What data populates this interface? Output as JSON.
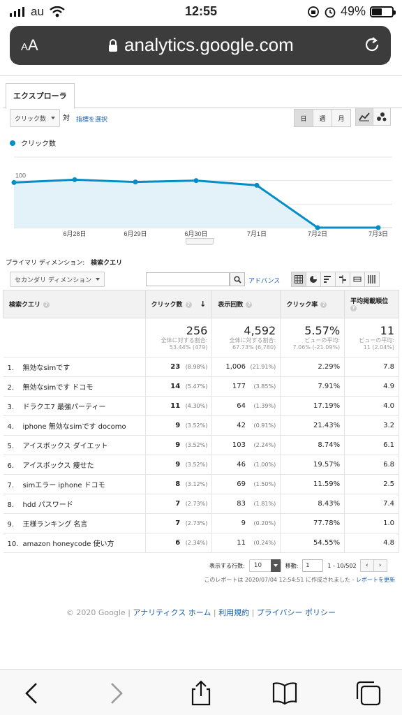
{
  "status": {
    "carrier": "au",
    "time": "12:55",
    "battery": "49%"
  },
  "browser": {
    "aa_label": "AA",
    "url": "analytics.google.com"
  },
  "tab": "エクスプローラ",
  "controls": {
    "metric_select": "クリック数",
    "vs_label": "対",
    "choose_metric": "指標を選択",
    "period_buttons": [
      "日",
      "週",
      "月"
    ]
  },
  "legend": "クリック数",
  "chart_data": {
    "type": "area",
    "series": [
      {
        "name": "クリック数",
        "values": [
          96,
          102,
          97,
          100,
          90,
          0,
          0
        ]
      }
    ],
    "x": [
      "",
      "6月28日",
      "6月29日",
      "6月30日",
      "7月1日",
      "7月2日",
      "7月3日"
    ],
    "yticks": [
      150,
      100,
      50
    ],
    "ylim": [
      0,
      150
    ],
    "color": "#058dc7"
  },
  "primary_dimension": {
    "label": "プライマリ ディメンション:",
    "value": "検索クエリ"
  },
  "secondary_dimension": "セカンダリ ディメンション",
  "advanced": "アドバンス",
  "table": {
    "headers": [
      "検索クエリ",
      "クリック数",
      "表示回数",
      "クリック率",
      "平均掲載順位"
    ],
    "totals": [
      {
        "big": "256",
        "sub1": "全体に対する割合:",
        "sub2": "53.44% (479)"
      },
      {
        "big": "4,592",
        "sub1": "全体に対する割合:",
        "sub2": "67.73% (6,780)"
      },
      {
        "big": "5.57%",
        "sub1": "ビューの平均:",
        "sub2": "7.06% (-21.09%)"
      },
      {
        "big": "11",
        "sub1": "ビューの平均:",
        "sub2": "11 (2.04%)"
      }
    ],
    "rows": [
      {
        "n": "1.",
        "q": "無効なsimです",
        "c": "23",
        "cp": "(8.98%)",
        "i": "1,006",
        "ip": "(21.91%)",
        "r": "2.29%",
        "p": "7.8"
      },
      {
        "n": "2.",
        "q": "無効なsimです ドコモ",
        "c": "14",
        "cp": "(5.47%)",
        "i": "177",
        "ip": "(3.85%)",
        "r": "7.91%",
        "p": "4.9"
      },
      {
        "n": "3.",
        "q": "ドラクエ7 最強パーティー",
        "c": "11",
        "cp": "(4.30%)",
        "i": "64",
        "ip": "(1.39%)",
        "r": "17.19%",
        "p": "4.0"
      },
      {
        "n": "4.",
        "q": "iphone 無効なsimです docomo",
        "c": "9",
        "cp": "(3.52%)",
        "i": "42",
        "ip": "(0.91%)",
        "r": "21.43%",
        "p": "3.2"
      },
      {
        "n": "5.",
        "q": "アイスボックス ダイエット",
        "c": "9",
        "cp": "(3.52%)",
        "i": "103",
        "ip": "(2.24%)",
        "r": "8.74%",
        "p": "6.1"
      },
      {
        "n": "6.",
        "q": "アイスボックス 痩せた",
        "c": "9",
        "cp": "(3.52%)",
        "i": "46",
        "ip": "(1.00%)",
        "r": "19.57%",
        "p": "6.8"
      },
      {
        "n": "7.",
        "q": "simエラー iphone ドコモ",
        "c": "8",
        "cp": "(3.12%)",
        "i": "69",
        "ip": "(1.50%)",
        "r": "11.59%",
        "p": "2.5"
      },
      {
        "n": "8.",
        "q": "hdd パスワード",
        "c": "7",
        "cp": "(2.73%)",
        "i": "83",
        "ip": "(1.81%)",
        "r": "8.43%",
        "p": "7.4"
      },
      {
        "n": "9.",
        "q": "王様ランキング 名言",
        "c": "7",
        "cp": "(2.73%)",
        "i": "9",
        "ip": "(0.20%)",
        "r": "77.78%",
        "p": "1.0"
      },
      {
        "n": "10.",
        "q": "amazon honeycode 使い方",
        "c": "6",
        "cp": "(2.34%)",
        "i": "11",
        "ip": "(0.24%)",
        "r": "54.55%",
        "p": "4.8"
      }
    ]
  },
  "pager": {
    "rows_label": "表示する行数:",
    "rows_value": "10",
    "goto_label": "移動:",
    "goto_value": "1",
    "range": "1 - 10/502"
  },
  "report_note": "このレポートは 2020/07/04 12:54:51 に作成されました -",
  "refresh_link": "レポートを更新",
  "footer": {
    "copyright": "© 2020 Google",
    "links": [
      "アナリティクス ホーム",
      "利用規約",
      "プライバシー ポリシー"
    ]
  }
}
